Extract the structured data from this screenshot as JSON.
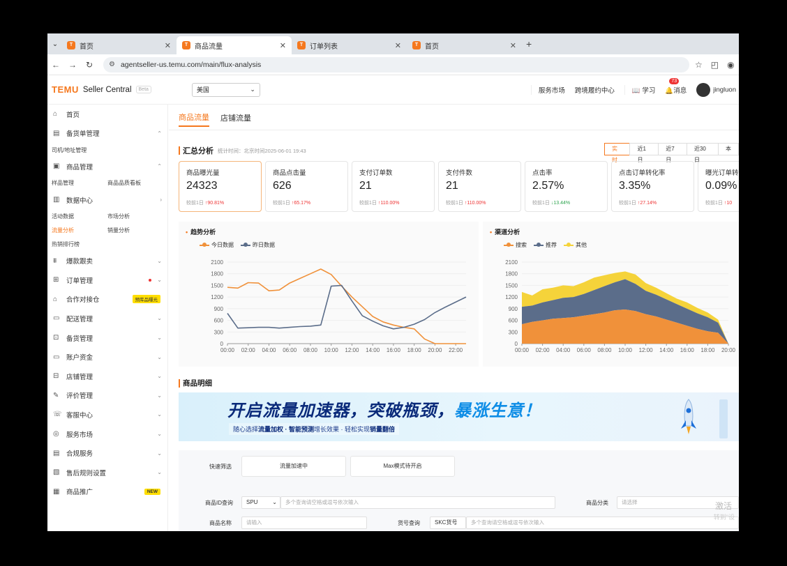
{
  "browser": {
    "tabs": [
      {
        "label": "首页",
        "active": false
      },
      {
        "label": "商品流量",
        "active": true
      },
      {
        "label": "订单列表",
        "active": false
      },
      {
        "label": "首页",
        "active": false
      }
    ],
    "url": "agentseller-us.temu.com/main/flux-analysis"
  },
  "header": {
    "logo": "TEMU",
    "product": "Seller Central",
    "beta": "Beta",
    "region": "美国",
    "links": [
      "服务市场",
      "跨境履约中心"
    ],
    "learn": "学习",
    "messages": "消息",
    "message_count": "73",
    "user": "jingluon"
  },
  "sidebar": {
    "home": "首页",
    "stock_order": "备货单管理",
    "stock_sub": [
      "司机/地址管理"
    ],
    "goods": "商品管理",
    "goods_sub": [
      "样品管理",
      "商品品质看板"
    ],
    "data_center": "数据中心",
    "data_sub_row1": [
      "活动数据",
      "市场分析"
    ],
    "data_sub_row2": [
      "流量分析",
      "销量分析"
    ],
    "data_sub_row3": [
      "热销排行榜"
    ],
    "items": [
      {
        "label": "爆款跟卖",
        "icon": "hot-icon"
      },
      {
        "label": "订单管理",
        "icon": "order-icon"
      },
      {
        "label": "合作对接仓",
        "icon": "warehouse-icon",
        "tag": "预库品曝光"
      },
      {
        "label": "配送管理",
        "icon": "delivery-icon"
      },
      {
        "label": "备货管理",
        "icon": "stock-icon"
      },
      {
        "label": "账户资金",
        "icon": "wallet-icon"
      },
      {
        "label": "店铺管理",
        "icon": "shop-icon"
      },
      {
        "label": "评价管理",
        "icon": "review-icon"
      },
      {
        "label": "客服中心",
        "icon": "service-icon"
      },
      {
        "label": "服务市场",
        "icon": "market-icon"
      },
      {
        "label": "合规服务",
        "icon": "compliance-icon"
      },
      {
        "label": "售后规则设置",
        "icon": "aftersale-icon"
      },
      {
        "label": "商品推广",
        "icon": "promo-icon",
        "tag": "NEW"
      }
    ]
  },
  "page_tabs": [
    "商品流量",
    "店铺流量"
  ],
  "summary": {
    "title": "汇总分析",
    "time": "统计时间：北京时间2025-06-01 19:43",
    "ranges": [
      "实时",
      "近1日",
      "近7日",
      "近30日",
      "本"
    ],
    "cards": [
      {
        "title": "商品曝光量",
        "value": "24323",
        "cmp": "较前1日",
        "change": "90.81%",
        "dir": "up"
      },
      {
        "title": "商品点击量",
        "value": "626",
        "cmp": "较前1日",
        "change": "65.17%",
        "dir": "up"
      },
      {
        "title": "支付订单数",
        "value": "21",
        "cmp": "较前1日",
        "change": "110.00%",
        "dir": "up"
      },
      {
        "title": "支付件数",
        "value": "21",
        "cmp": "较前1日",
        "change": "110.00%",
        "dir": "up"
      },
      {
        "title": "点击率",
        "value": "2.57%",
        "cmp": "较前1日",
        "change": "13.44%",
        "dir": "down"
      },
      {
        "title": "点击订单转化率",
        "value": "3.35%",
        "cmp": "较前1日",
        "change": "27.14%",
        "dir": "up"
      },
      {
        "title": "曝光订单转",
        "value": "0.09%",
        "cmp": "较前1日",
        "change": "10",
        "dir": "up"
      }
    ]
  },
  "chart_data": [
    {
      "type": "line",
      "title": "趋势分析",
      "x": [
        "00:00",
        "01:00",
        "02:00",
        "03:00",
        "04:00",
        "05:00",
        "06:00",
        "07:00",
        "08:00",
        "09:00",
        "10:00",
        "11:00",
        "12:00",
        "13:00",
        "14:00",
        "15:00",
        "16:00",
        "17:00",
        "18:00",
        "19:00",
        "20:00",
        "21:00",
        "22:00",
        "23:00"
      ],
      "xticks": [
        "00:00",
        "02:00",
        "04:00",
        "06:00",
        "08:00",
        "10:00",
        "12:00",
        "14:00",
        "16:00",
        "18:00",
        "20:00",
        "22:00"
      ],
      "ylim": [
        0,
        2100
      ],
      "yticks": [
        0,
        300,
        600,
        900,
        1200,
        1500,
        1800,
        2100
      ],
      "series": [
        {
          "name": "今日数据",
          "color": "#f0913a",
          "values": [
            1450,
            1430,
            1570,
            1560,
            1360,
            1380,
            1560,
            1680,
            1800,
            1920,
            1780,
            1480,
            1200,
            950,
            700,
            560,
            480,
            420,
            380,
            120,
            0,
            0,
            0,
            0
          ]
        },
        {
          "name": "昨日数据",
          "color": "#5b6d8a",
          "values": [
            780,
            400,
            410,
            420,
            420,
            400,
            420,
            440,
            450,
            480,
            1480,
            1500,
            1100,
            720,
            580,
            460,
            380,
            420,
            500,
            620,
            800,
            940,
            1070,
            1200
          ]
        }
      ]
    },
    {
      "type": "area",
      "title": "渠道分析",
      "x": [
        "00:00",
        "01:00",
        "02:00",
        "03:00",
        "04:00",
        "05:00",
        "06:00",
        "07:00",
        "08:00",
        "09:00",
        "10:00",
        "11:00",
        "12:00",
        "13:00",
        "14:00",
        "15:00",
        "16:00",
        "17:00",
        "18:00",
        "19:00",
        "20:00"
      ],
      "xticks": [
        "00:00",
        "02:00",
        "04:00",
        "06:00",
        "08:00",
        "10:00",
        "12:00",
        "14:00",
        "16:00",
        "18:00",
        "20:00"
      ],
      "ylim": [
        0,
        2100
      ],
      "yticks": [
        0,
        300,
        600,
        900,
        1200,
        1500,
        1800,
        2100
      ],
      "stacked": true,
      "series": [
        {
          "name": "搜索",
          "color": "#f0913a",
          "values": [
            500,
            560,
            600,
            640,
            660,
            680,
            720,
            760,
            800,
            860,
            880,
            840,
            760,
            700,
            620,
            540,
            460,
            380,
            320,
            280,
            0
          ]
        },
        {
          "name": "推荐",
          "color": "#5b6d8a",
          "values": [
            450,
            420,
            460,
            480,
            520,
            520,
            560,
            620,
            680,
            720,
            780,
            700,
            600,
            560,
            520,
            480,
            440,
            400,
            360,
            260,
            0
          ]
        },
        {
          "name": "其他",
          "color": "#f5d33a",
          "values": [
            380,
            260,
            340,
            320,
            320,
            280,
            300,
            320,
            280,
            240,
            200,
            240,
            200,
            180,
            160,
            140,
            160,
            140,
            120,
            80,
            0
          ]
        }
      ]
    }
  ],
  "detail": {
    "title": "商品明细",
    "banner_title_a": "开启流量加速器，突破瓶颈，",
    "banner_title_b": "暴涨生意！",
    "banner_sub_a": "随心选择",
    "banner_sub_b": "流量加权",
    "banner_sub_c": " · 智能预测",
    "banner_sub_d": "增长效果 · 轻松实现",
    "banner_sub_e": "销量翻倍"
  },
  "filters": {
    "quick_label": "快速筛选",
    "quick_btn1": "流量加速中",
    "quick_btn2": "Max模式待开启",
    "id_label": "商品ID查询",
    "id_select": "SPU",
    "id_placeholder": "多个查询请空格或逗号依次输入",
    "cat_label": "商品分类",
    "cat_placeholder": "请选择",
    "name_label": "商品名称",
    "name_placeholder": "请输入",
    "sku_label": "货号查询",
    "sku_select": "SKC货号",
    "sku_placeholder": "多个查询请空格或逗号依次输入"
  },
  "watermark": {
    "line1": "激活",
    "line2": "转到\"设"
  }
}
